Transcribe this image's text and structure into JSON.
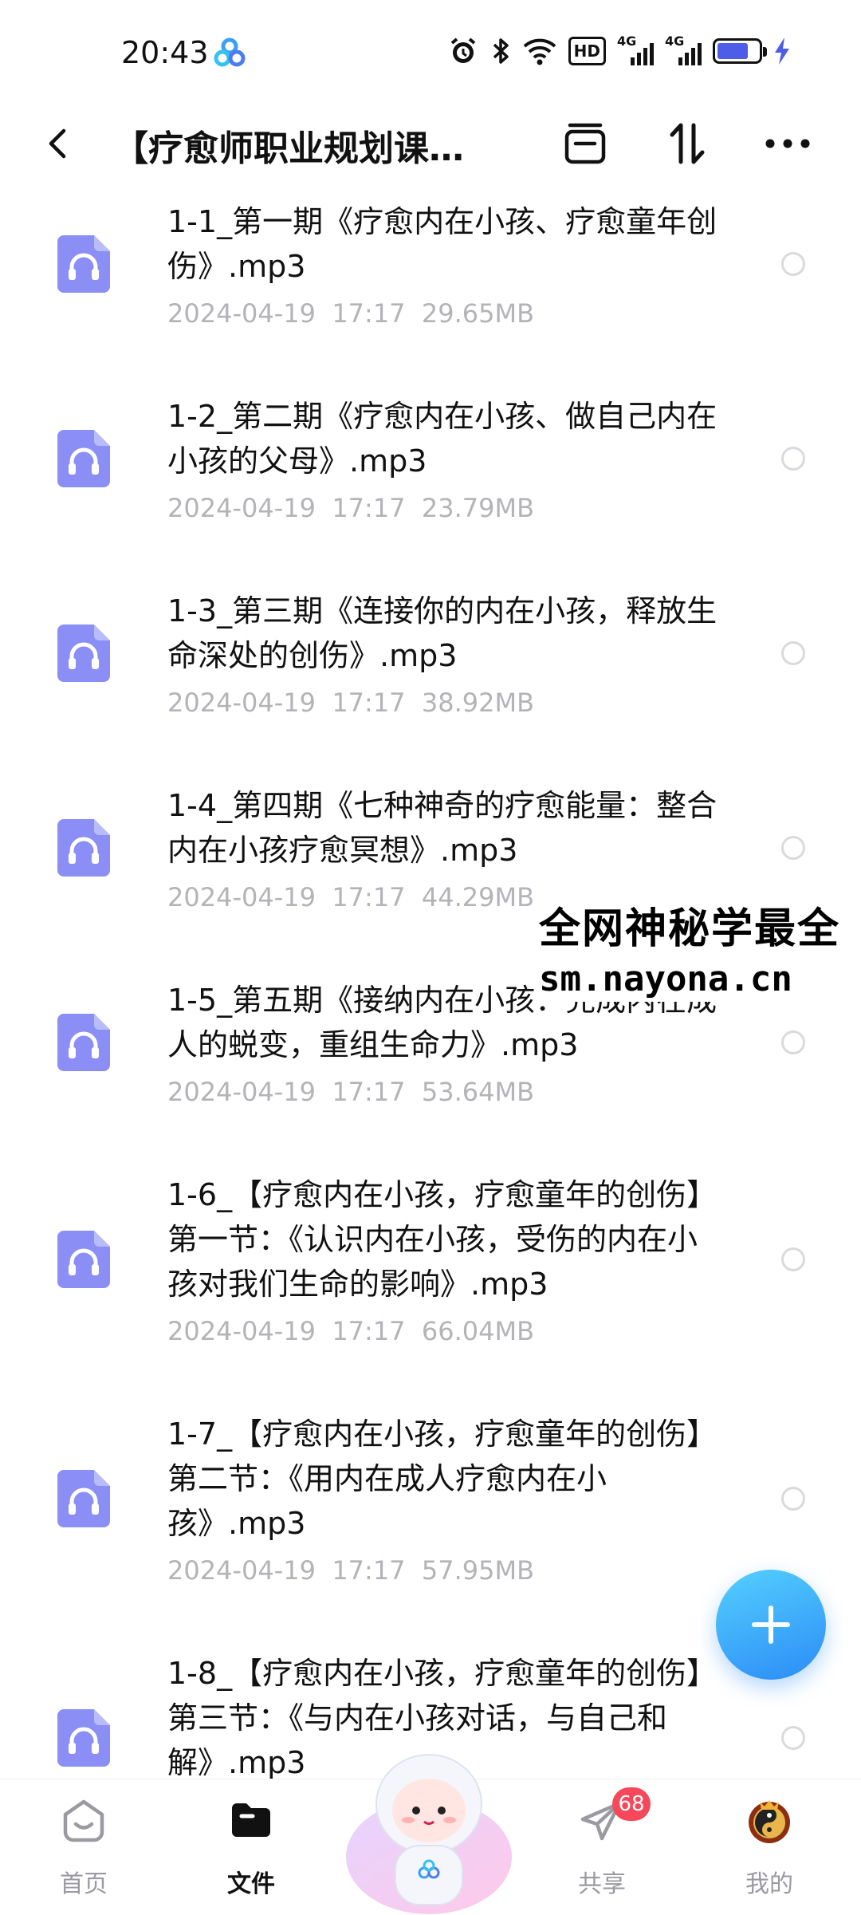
{
  "status_bar": {
    "time": "20:43",
    "hd_label": "HD",
    "net1": "4G",
    "net2": "4G",
    "icons": [
      "baidu-cloud-icon",
      "alarm-icon",
      "bluetooth-icon",
      "wifi-icon",
      "hd-icon",
      "signal-icon",
      "signal-icon",
      "battery-icon",
      "charging-icon"
    ]
  },
  "header": {
    "title": "【疗愈师职业规划课程】",
    "buttons": [
      "back-icon",
      "select-all-icon",
      "sort-icon",
      "more-icon"
    ]
  },
  "files": [
    {
      "name": "1-1_第一期《疗愈内在小孩、疗愈童年创伤》.mp3",
      "date": "2024-04-19",
      "time": "17:17",
      "size": "29.65MB"
    },
    {
      "name": "1-2_第二期《疗愈内在小孩、做自己内在小孩的父母》.mp3",
      "date": "2024-04-19",
      "time": "17:17",
      "size": "23.79MB"
    },
    {
      "name": "1-3_第三期《连接你的内在小孩，释放生命深处的创伤》.mp3",
      "date": "2024-04-19",
      "time": "17:17",
      "size": "38.92MB"
    },
    {
      "name": "1-4_第四期《七种神奇的疗愈能量：整合内在小孩疗愈冥想》.mp3",
      "date": "2024-04-19",
      "time": "17:17",
      "size": "44.29MB"
    },
    {
      "name": "1-5_第五期《接纳内在小孩：完成内在成人的蜕变，重组生命力》.mp3",
      "date": "2024-04-19",
      "time": "17:17",
      "size": "53.64MB"
    },
    {
      "name": "1-6_【疗愈内在小孩，疗愈童年的创伤】第一节：《认识内在小孩，受伤的内在小孩对我们生命的影响》.mp3",
      "date": "2024-04-19",
      "time": "17:17",
      "size": "66.04MB"
    },
    {
      "name": "1-7_【疗愈内在小孩，疗愈童年的创伤】第二节：《用内在成人疗愈内在小孩》.mp3",
      "date": "2024-04-19",
      "time": "17:17",
      "size": "57.95MB"
    },
    {
      "name": "1-8_【疗愈内在小孩，疗愈童年的创伤】第三节：《与内在小孩对话，与自己和解》.mp3",
      "date": "",
      "time": "",
      "size": ""
    }
  ],
  "watermark": {
    "line1": "全网神秘学最全",
    "line2": "sm.nayona.cn"
  },
  "fab": {
    "icon": "plus-icon"
  },
  "nav": {
    "items": [
      {
        "label": "首页",
        "icon": "home-icon",
        "active": false
      },
      {
        "label": "文件",
        "icon": "folder-icon",
        "active": true
      },
      {
        "label": "",
        "icon": "mascot-icon",
        "active": false
      },
      {
        "label": "共享",
        "icon": "share-icon",
        "active": false,
        "badge": "68"
      },
      {
        "label": "我的",
        "icon": "avatar-icon",
        "active": false
      }
    ]
  },
  "colors": {
    "accent": "#2b8cf6",
    "file_icon": "#8a8ef5",
    "meta_text": "#b3b3b8",
    "badge": "#f6485b"
  }
}
